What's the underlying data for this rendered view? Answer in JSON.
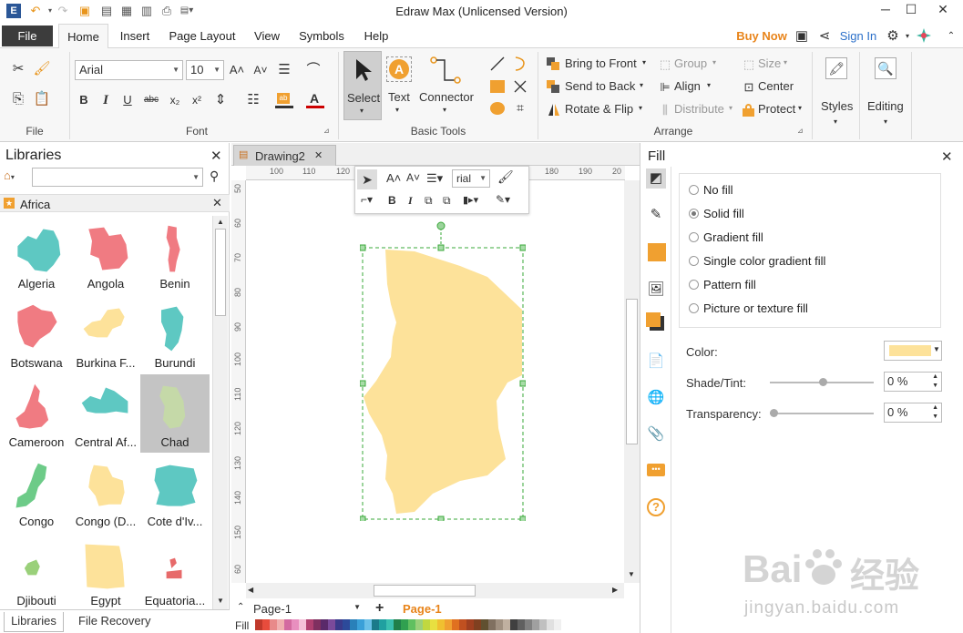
{
  "app": {
    "title": "Edraw Max (Unlicensed Version)"
  },
  "menu": {
    "file": "File",
    "tabs": [
      "Home",
      "Insert",
      "Page Layout",
      "View",
      "Symbols",
      "Help"
    ],
    "buy_now": "Buy Now",
    "sign_in": "Sign In"
  },
  "ribbon": {
    "file_group": "File",
    "font_group": "Font",
    "font_name": "Arial",
    "font_size": "10",
    "basic_tools_group": "Basic Tools",
    "select": "Select",
    "text": "Text",
    "connector": "Connector",
    "arrange_group": "Arrange",
    "bring_to_front": "Bring to Front",
    "send_to_back": "Send to Back",
    "rotate_flip": "Rotate & Flip",
    "group": "Group",
    "align": "Align",
    "distribute": "Distribute",
    "size": "Size",
    "center": "Center",
    "protect": "Protect",
    "styles": "Styles",
    "editing": "Editing"
  },
  "libraries": {
    "title": "Libraries",
    "search_value": "",
    "category": "Africa",
    "items": [
      {
        "label": "Algeria",
        "color": "#5ec8c2"
      },
      {
        "label": "Angola",
        "color": "#f07b82"
      },
      {
        "label": "Benin",
        "color": "#f07b82"
      },
      {
        "label": "Botswana",
        "color": "#f07b82"
      },
      {
        "label": "Burkina F...",
        "color": "#fde29a"
      },
      {
        "label": "Burundi",
        "color": "#5ec8c2"
      },
      {
        "label": "Cameroon",
        "color": "#f07b82"
      },
      {
        "label": "Central Af...",
        "color": "#5ec8c2"
      },
      {
        "label": "Chad",
        "color": "#c5d9a8"
      },
      {
        "label": "Congo",
        "color": "#6dcb88"
      },
      {
        "label": "Congo (D...",
        "color": "#fde29a"
      },
      {
        "label": "Cote d'Iv...",
        "color": "#5ec8c2"
      },
      {
        "label": "Djibouti",
        "color": "#9ad07a"
      },
      {
        "label": "Egypt",
        "color": "#fde29a"
      },
      {
        "label": "Equatoria...",
        "color": "#e76a6a"
      }
    ],
    "bottom_tabs": [
      "Libraries",
      "File Recovery"
    ]
  },
  "document": {
    "tab": "Drawing2",
    "ruler_h": [
      "100",
      "110",
      "120",
      "180",
      "190",
      "20"
    ],
    "ruler_v": [
      "50",
      "60",
      "70",
      "80",
      "90",
      "100",
      "110",
      "120",
      "130",
      "140",
      "150",
      "60"
    ],
    "mini_font": "rial",
    "page_select": "Page-1",
    "page_tab": "Page-1",
    "fill_label": "Fill",
    "shape_color": "#fde29a"
  },
  "fill_panel": {
    "title": "Fill",
    "options": [
      "No fill",
      "Solid fill",
      "Gradient fill",
      "Single color gradient fill",
      "Pattern fill",
      "Picture or texture fill"
    ],
    "selected": "Solid fill",
    "color_label": "Color:",
    "color_value": "#fde29a",
    "shade_label": "Shade/Tint:",
    "shade_value": "0 %",
    "transparency_label": "Transparency:",
    "transparency_value": "0 %"
  },
  "watermark": {
    "brand": "Bai",
    "brand2": "经验",
    "url": "jingyan.baidu.com"
  }
}
